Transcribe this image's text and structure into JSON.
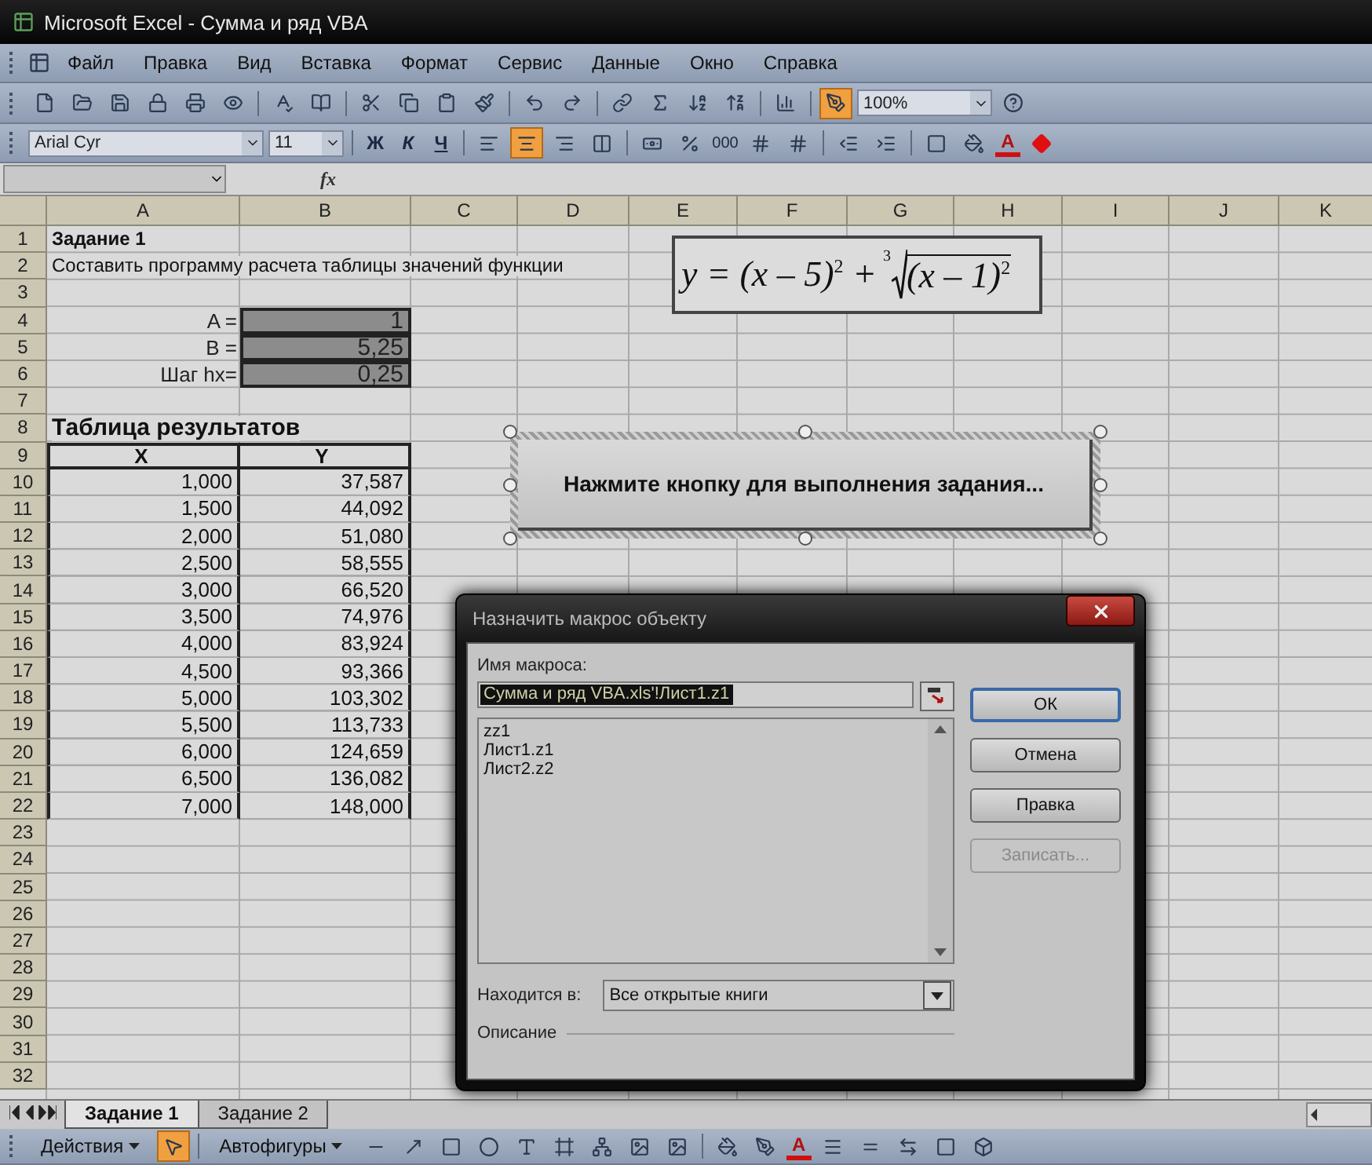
{
  "window": {
    "title": "Microsoft Excel - Сумма и ряд VBA"
  },
  "menu": [
    "Файл",
    "Правка",
    "Вид",
    "Вставка",
    "Формат",
    "Сервис",
    "Данные",
    "Окно",
    "Справка"
  ],
  "standard_toolbar": {
    "drawing_on": true,
    "zoom": "100%"
  },
  "format_toolbar": {
    "font": "Arial Cyr",
    "size": "11",
    "bold": "Ж",
    "italic": "К",
    "underline": "Ч",
    "align": [
      {
        "selected": false
      },
      {
        "selected": true
      },
      {
        "selected": false
      }
    ],
    "thousands": "000",
    "font_color": "A"
  },
  "formula_bar": {
    "fx": "fx"
  },
  "sheet": {
    "columns": [
      "A",
      "B",
      "C",
      "D",
      "E",
      "F",
      "G",
      "H",
      "I",
      "J",
      "K"
    ],
    "rows": [
      {
        "number": "1",
        "kind": "title",
        "cells": [
          "Задание 1"
        ]
      },
      {
        "number": "2",
        "kind": "text",
        "cells": [
          "Составить программу расчета таблицы значений функции"
        ]
      },
      {
        "number": "3",
        "kind": "blank"
      },
      {
        "number": "4",
        "kind": "param",
        "cells": [
          "A =",
          "1"
        ]
      },
      {
        "number": "5",
        "kind": "param",
        "cells": [
          "B =",
          "5,25"
        ]
      },
      {
        "number": "6",
        "kind": "param",
        "cells": [
          "Шаг hx=",
          "0,25"
        ]
      },
      {
        "number": "7",
        "kind": "blank"
      },
      {
        "number": "8",
        "kind": "heading",
        "cells": [
          "Таблица результатов"
        ]
      },
      {
        "number": "9",
        "kind": "header",
        "cells": [
          "X",
          "Y"
        ]
      },
      {
        "number": "10",
        "kind": "value",
        "cells": [
          "1,000",
          "37,587"
        ]
      },
      {
        "number": "11",
        "kind": "value",
        "cells": [
          "1,500",
          "44,092"
        ]
      },
      {
        "number": "12",
        "kind": "value",
        "cells": [
          "2,000",
          "51,080"
        ]
      },
      {
        "number": "13",
        "kind": "value",
        "cells": [
          "2,500",
          "58,555"
        ]
      },
      {
        "number": "14",
        "kind": "value",
        "cells": [
          "3,000",
          "66,520"
        ]
      },
      {
        "number": "15",
        "kind": "value",
        "cells": [
          "3,500",
          "74,976"
        ]
      },
      {
        "number": "16",
        "kind": "value",
        "cells": [
          "4,000",
          "83,924"
        ]
      },
      {
        "number": "17",
        "kind": "value",
        "cells": [
          "4,500",
          "93,366"
        ]
      },
      {
        "number": "18",
        "kind": "value",
        "cells": [
          "5,000",
          "103,302"
        ]
      },
      {
        "number": "19",
        "kind": "value",
        "cells": [
          "5,500",
          "113,733"
        ]
      },
      {
        "number": "20",
        "kind": "value",
        "cells": [
          "6,000",
          "124,659"
        ]
      },
      {
        "number": "21",
        "kind": "value",
        "cells": [
          "6,500",
          "136,082"
        ]
      },
      {
        "number": "22",
        "kind": "value",
        "cells": [
          "7,000",
          "148,000"
        ]
      },
      {
        "number": "23",
        "kind": "blank"
      },
      {
        "number": "24",
        "kind": "blank"
      },
      {
        "number": "25",
        "kind": "blank"
      },
      {
        "number": "26",
        "kind": "blank"
      },
      {
        "number": "27",
        "kind": "blank"
      },
      {
        "number": "28",
        "kind": "blank"
      },
      {
        "number": "29",
        "kind": "blank"
      },
      {
        "number": "30",
        "kind": "blank"
      },
      {
        "number": "31",
        "kind": "blank"
      },
      {
        "number": "32",
        "kind": "blank"
      }
    ],
    "formula": {
      "before": "y = (x – 5)$^{2}$ +",
      "root_index": "3",
      "radicand": "(x – 1)$^{2}$"
    },
    "macro_button": {
      "label": "Нажмите кнопку для выполнения задания..."
    }
  },
  "sheet_tabs": [
    {
      "label": "Задание 1",
      "selected": true
    },
    {
      "label": "Задание 2",
      "selected": false
    }
  ],
  "drawing_toolbar": {
    "actions": "Действия",
    "select_on": true,
    "autoshapes": "Автофигуры",
    "font_color": "A"
  },
  "dialog": {
    "title": "Назначить макрос объекту",
    "name_label": "Имя макроса:",
    "name_value": "Сумма и ряд VBA.xls'!Лист1.z1",
    "macros": [
      {
        "label": "zz1",
        "selected": false
      },
      {
        "label": "Лист1.z1",
        "selected": false
      },
      {
        "label": "Лист2.z2",
        "selected": false
      }
    ],
    "buttons": [
      {
        "label": "ОК",
        "default": true,
        "disabled": false
      },
      {
        "label": "Отмена",
        "default": false,
        "disabled": false
      },
      {
        "label": "Правка",
        "default": false,
        "disabled": false
      },
      {
        "label": "Записать...",
        "default": false,
        "disabled": true
      }
    ],
    "location_label": "Находится в:",
    "location_value": "Все открытые книги",
    "description_label": "Описание"
  }
}
